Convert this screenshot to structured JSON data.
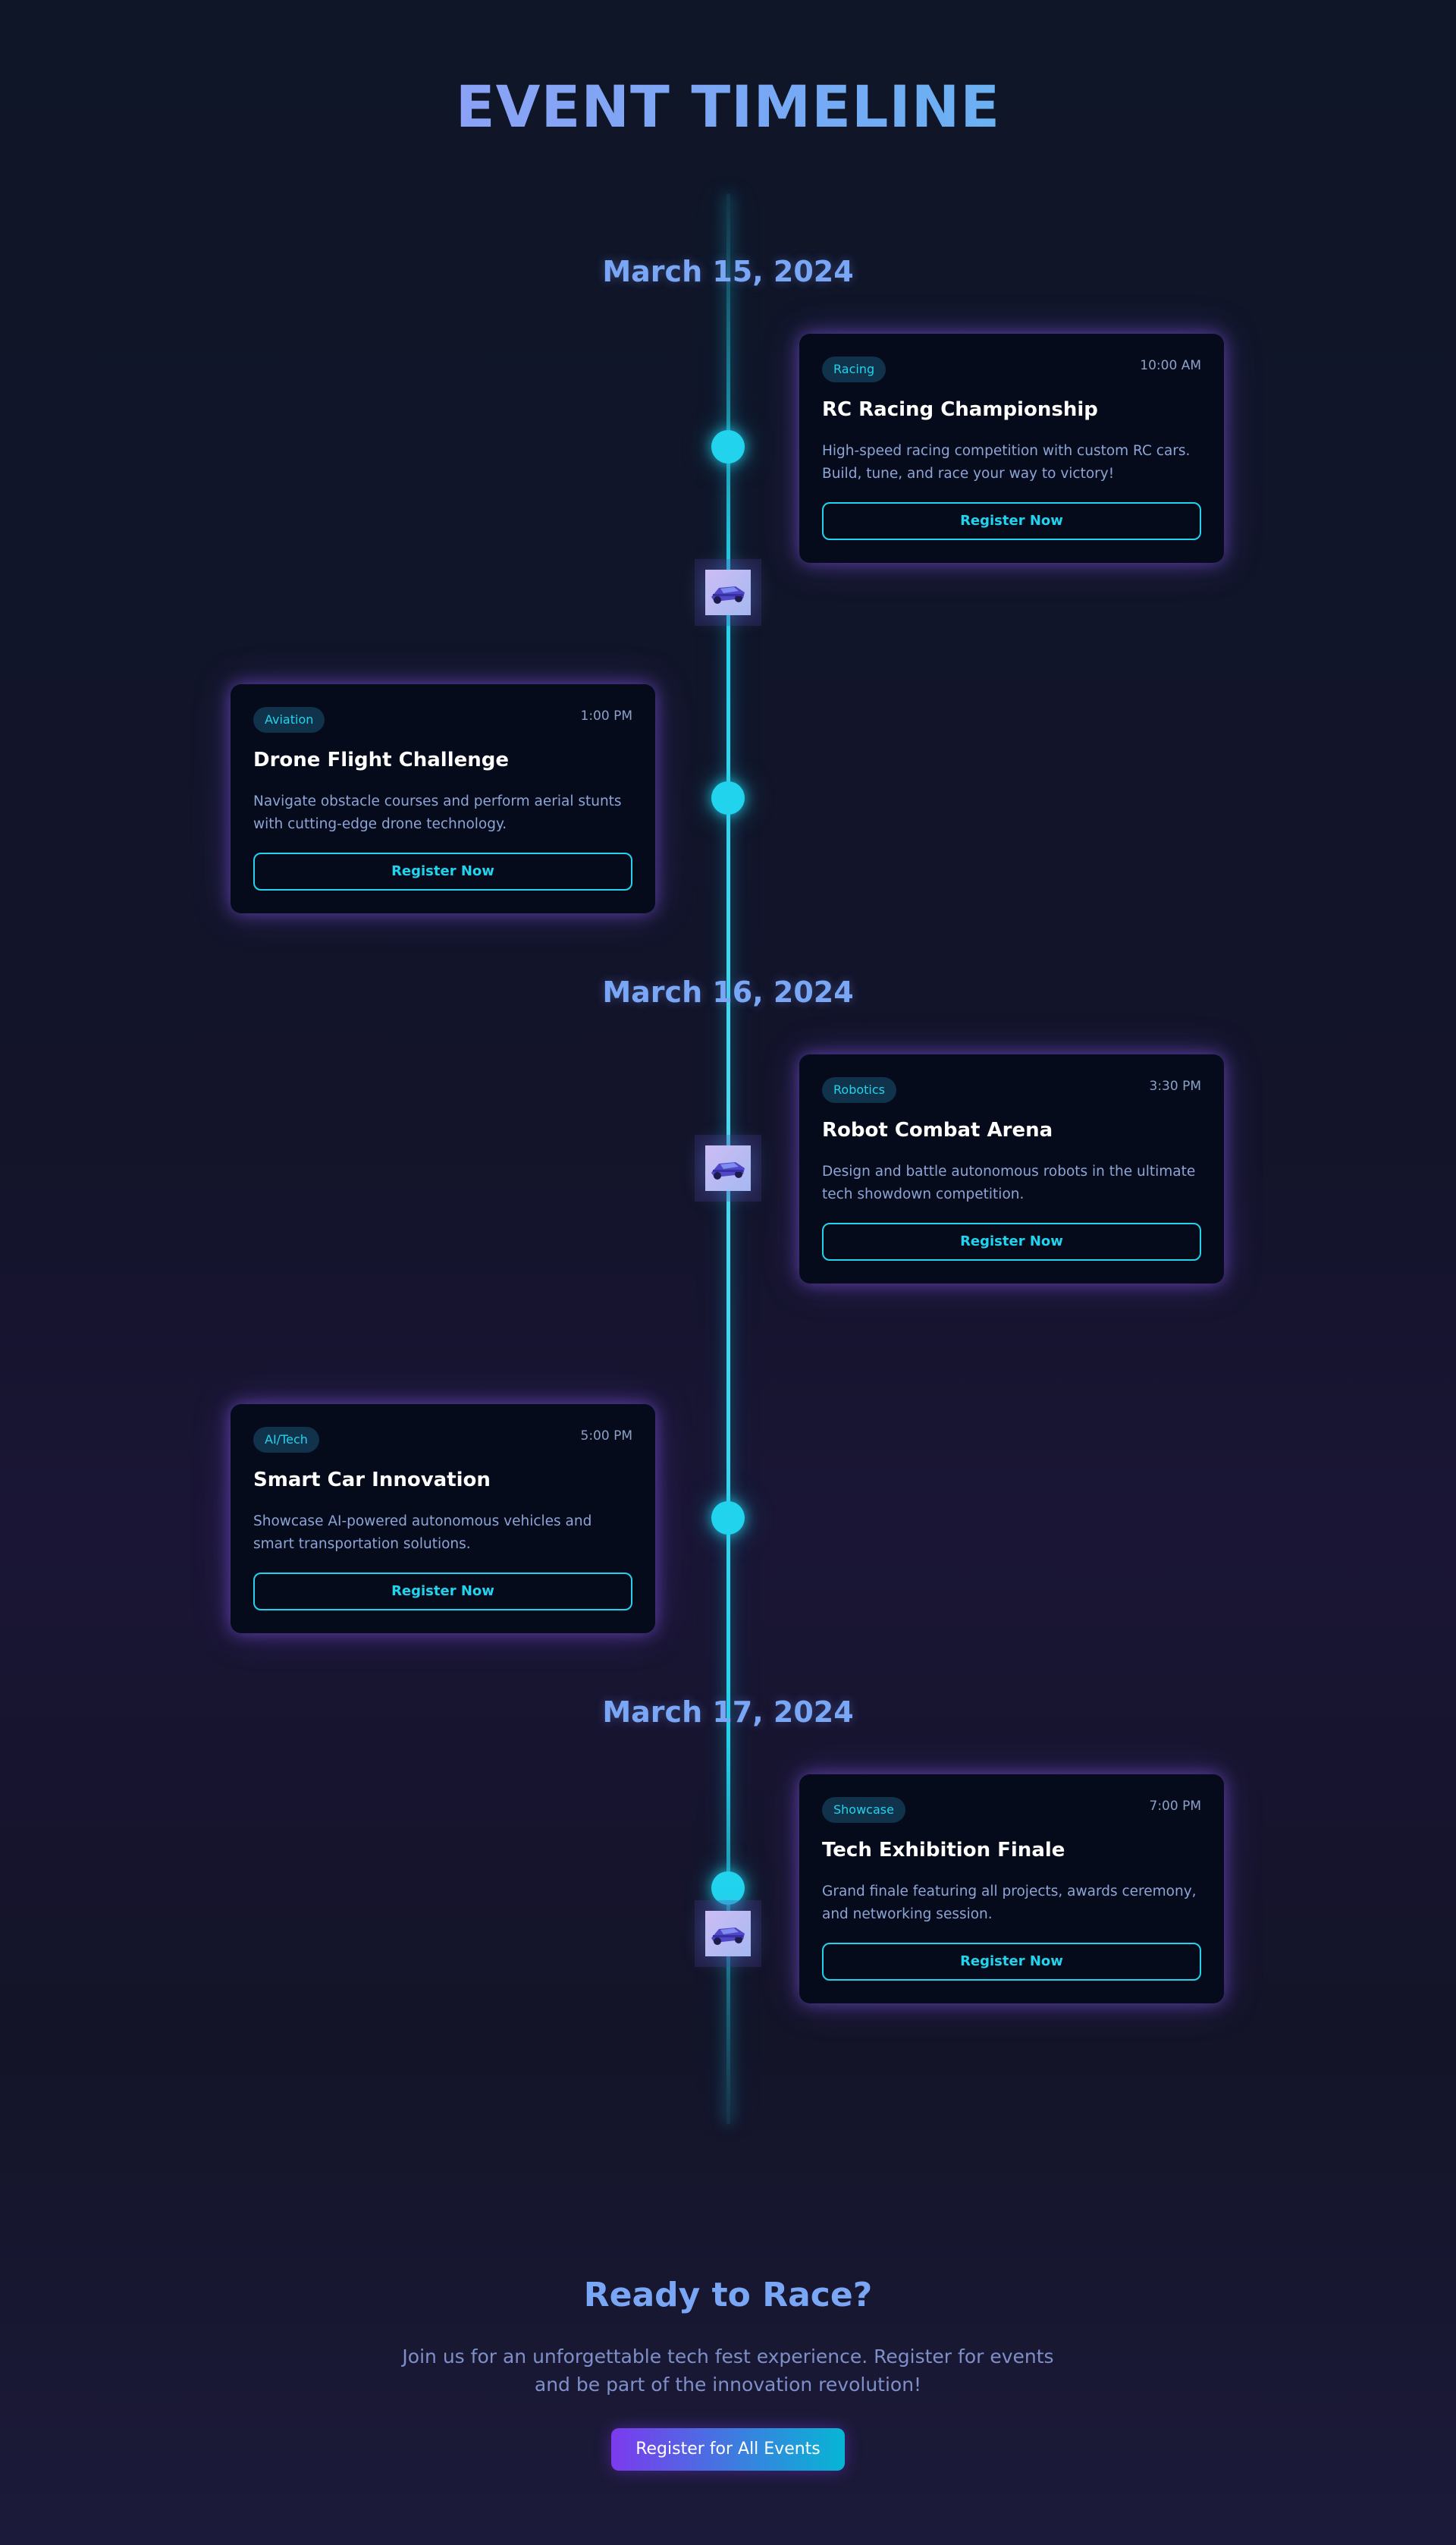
{
  "page": {
    "title": "EVENT TIMELINE"
  },
  "dates": [
    "March 15, 2024",
    "March 16, 2024",
    "March 17, 2024"
  ],
  "events": [
    {
      "tag": "Racing",
      "time": "10:00 AM",
      "title": "RC Racing Championship",
      "description": "High-speed racing competition with custom RC cars. Build, tune, and race your way to victory!",
      "button": "Register Now"
    },
    {
      "tag": "Aviation",
      "time": "1:00 PM",
      "title": "Drone Flight Challenge",
      "description": "Navigate obstacle courses and perform aerial stunts with cutting-edge drone technology.",
      "button": "Register Now"
    },
    {
      "tag": "Robotics",
      "time": "3:30 PM",
      "title": "Robot Combat Arena",
      "description": "Design and battle autonomous robots in the ultimate tech showdown competition.",
      "button": "Register Now"
    },
    {
      "tag": "AI/Tech",
      "time": "5:00 PM",
      "title": "Smart Car Innovation",
      "description": "Showcase AI-powered autonomous vehicles and smart transportation solutions.",
      "button": "Register Now"
    },
    {
      "tag": "Showcase",
      "time": "7:00 PM",
      "title": "Tech Exhibition Finale",
      "description": "Grand finale featuring all projects, awards ceremony, and networking session.",
      "button": "Register Now"
    }
  ],
  "cta": {
    "title": "Ready to Race?",
    "text": "Join us for an unforgettable tech fest experience. Register for events and be part of the innovation revolution!",
    "button": "Register for All Events"
  },
  "colors": {
    "accent": "#22d3ee",
    "card_bg": "#050b1a",
    "glow": "#8b5cf6",
    "date_color": "#7aa7f5"
  },
  "icons": [
    "rc-car-icon"
  ]
}
